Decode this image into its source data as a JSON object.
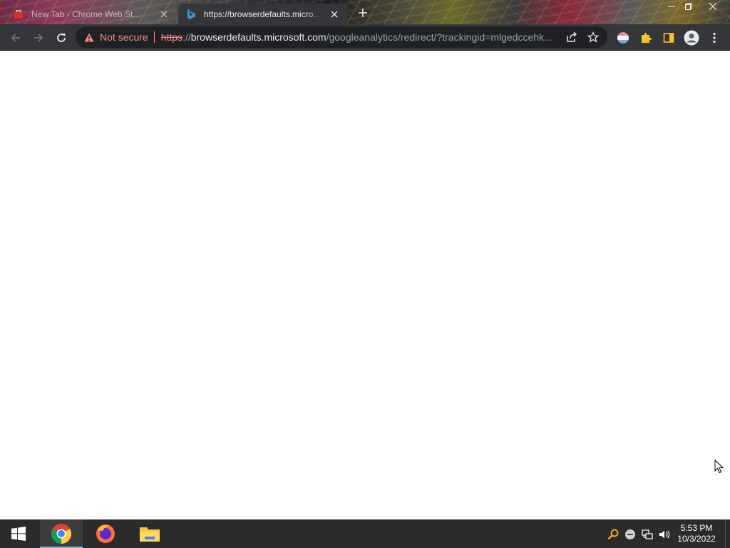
{
  "browser": {
    "tabs": [
      {
        "title": "New Tab - Chrome Web St...",
        "active": false
      },
      {
        "title": "https://browserdefaults.microsoft.com",
        "active": true
      }
    ],
    "security_label": "Not secure",
    "url": {
      "scheme": "https",
      "separator": "://",
      "host": "browserdefaults.microsoft.com",
      "path": "/googleanalytics/redirect/?trackingid=mlgedccehk..."
    }
  },
  "taskbar": {
    "apps": [
      "chrome-icon",
      "firefox-icon",
      "file-explorer-icon"
    ],
    "clock": {
      "time": "5:53 PM",
      "date": "10/3/2022"
    }
  },
  "colors": {
    "toolbar": "#35363a",
    "omnibox": "#202124",
    "warning": "#f28b82",
    "taskbar": "#2b2b2b"
  }
}
